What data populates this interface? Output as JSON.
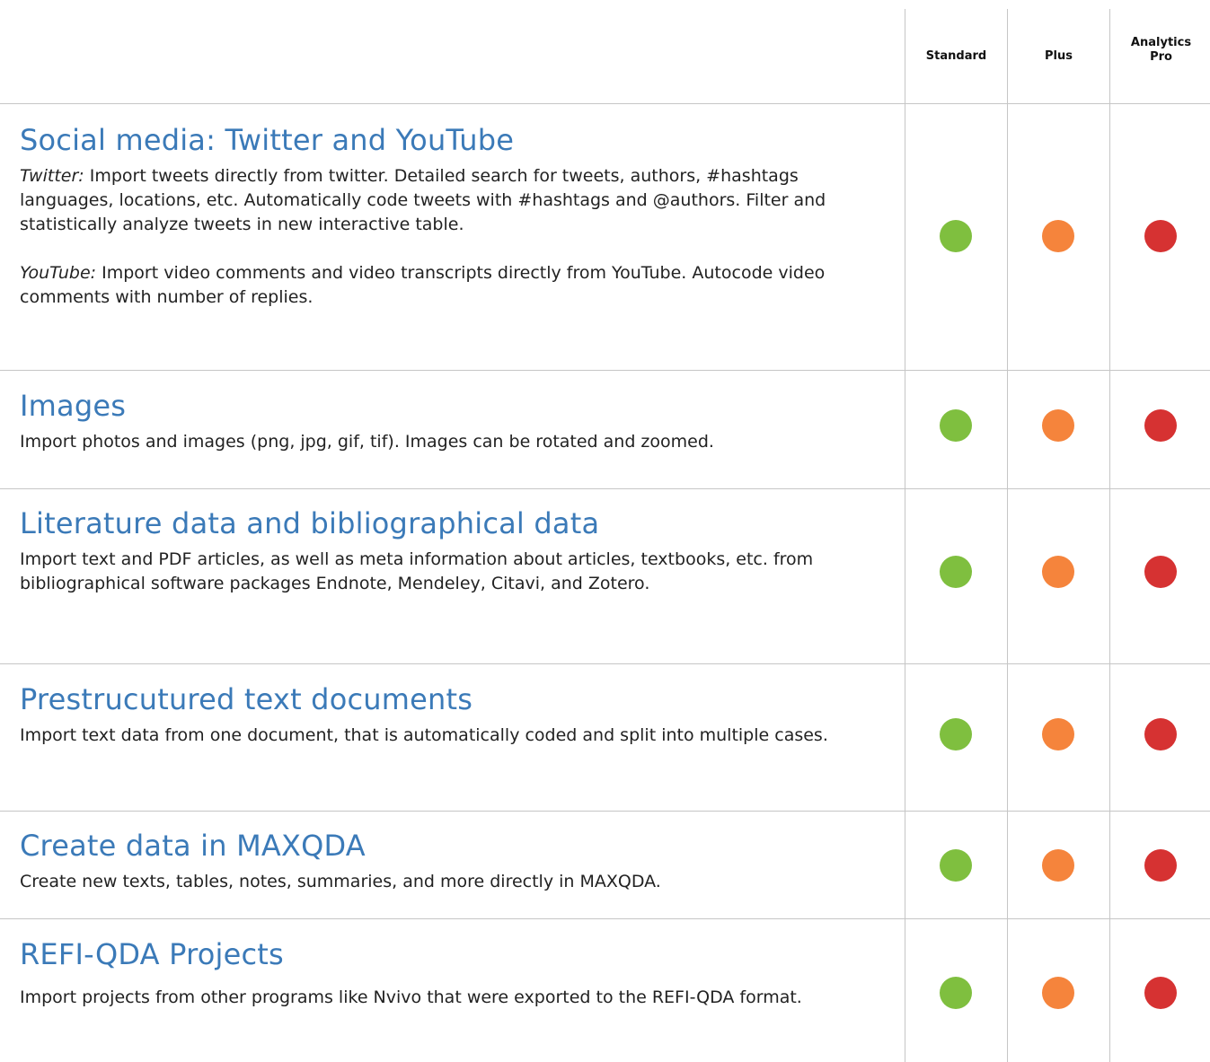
{
  "columns": [
    "Standard",
    "Plus",
    "Analytics\nPro"
  ],
  "colors": {
    "title": "#3b7ab8",
    "standard": "#7fbf3f",
    "plus": "#f5843c",
    "analytics_pro": "#d63232",
    "divider": "#c6c6c6"
  },
  "features": [
    {
      "title": "Social media: Twitter and YouTube",
      "p1_label": "Twitter:",
      "p1_text": " Import tweets directly from twitter. Detailed search for tweets, authors, #hashtags languages, locations, etc. Automatically code tweets with #hashtags and @authors. Filter and statistically analyze tweets in new interactive table.",
      "p2_label": "YouTube:",
      "p2_text": " Import video comments and video transcripts directly from YouTube. Autocode video comments with number of replies."
    },
    {
      "title": "Images",
      "desc": "Import photos and images (png, jpg, gif, tif). Images can be rotated and zoomed."
    },
    {
      "title": "Literature data and bibliographical data",
      "desc": "Import text and PDF articles, as well as meta information about articles, textbooks, etc. from bibliographical software packages Endnote, Mendeley, Citavi, and Zotero."
    },
    {
      "title": "Prestrucutured text documents",
      "desc": "Import text data from one document, that is automatically coded and split into multiple cases."
    },
    {
      "title": "Create data in MAXQDA",
      "desc": "Create new texts, tables, notes, summaries, and more directly in MAXQDA."
    },
    {
      "title": "REFI-QDA Projects",
      "desc": "Import projects from other programs like Nvivo that were exported to the REFI-QDA format."
    }
  ]
}
